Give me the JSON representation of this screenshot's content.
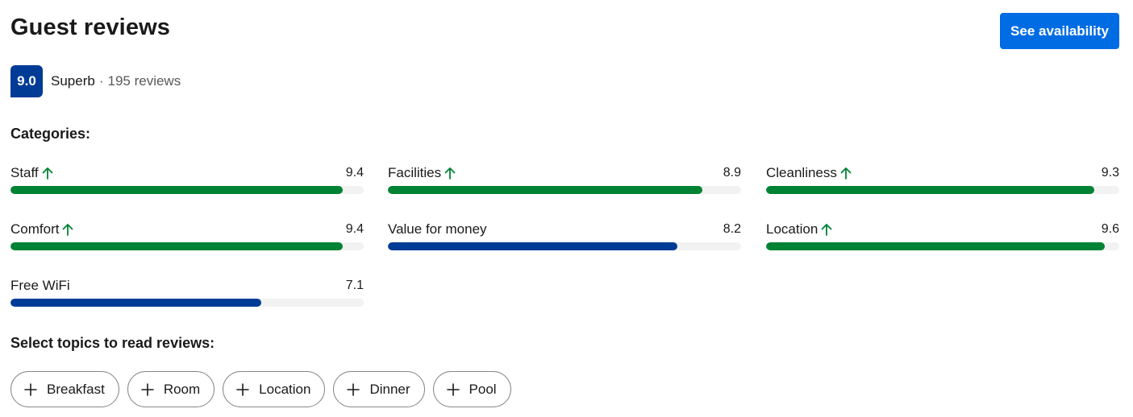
{
  "header": {
    "title": "Guest reviews",
    "cta_label": "See availability"
  },
  "summary": {
    "score": "9.0",
    "rating_word": "Superb",
    "separator": "·",
    "review_count": "195 reviews"
  },
  "categories_label": "Categories:",
  "categories": [
    {
      "name": "Staff",
      "score": "9.4",
      "fraction": 0.94,
      "trend_up": true,
      "color": "#008234"
    },
    {
      "name": "Facilities",
      "score": "8.9",
      "fraction": 0.89,
      "trend_up": true,
      "color": "#008234"
    },
    {
      "name": "Cleanliness",
      "score": "9.3",
      "fraction": 0.93,
      "trend_up": true,
      "color": "#008234"
    },
    {
      "name": "Comfort",
      "score": "9.4",
      "fraction": 0.94,
      "trend_up": true,
      "color": "#008234"
    },
    {
      "name": "Value for money",
      "score": "8.2",
      "fraction": 0.82,
      "trend_up": false,
      "color": "#003b95"
    },
    {
      "name": "Location",
      "score": "9.6",
      "fraction": 0.96,
      "trend_up": true,
      "color": "#008234"
    },
    {
      "name": "Free WiFi",
      "score": "7.1",
      "fraction": 0.71,
      "trend_up": false,
      "color": "#003b95"
    }
  ],
  "topics_label": "Select topics to read reviews:",
  "topics": [
    {
      "label": "Breakfast",
      "icon": "plus-icon"
    },
    {
      "label": "Room",
      "icon": "plus-icon"
    },
    {
      "label": "Location",
      "icon": "plus-icon"
    },
    {
      "label": "Dinner",
      "icon": "plus-icon"
    },
    {
      "label": "Pool",
      "icon": "plus-icon"
    }
  ],
  "colors": {
    "accent": "#006ce4",
    "badge": "#003b95",
    "high_score": "#008234",
    "normal_score": "#003b95"
  }
}
